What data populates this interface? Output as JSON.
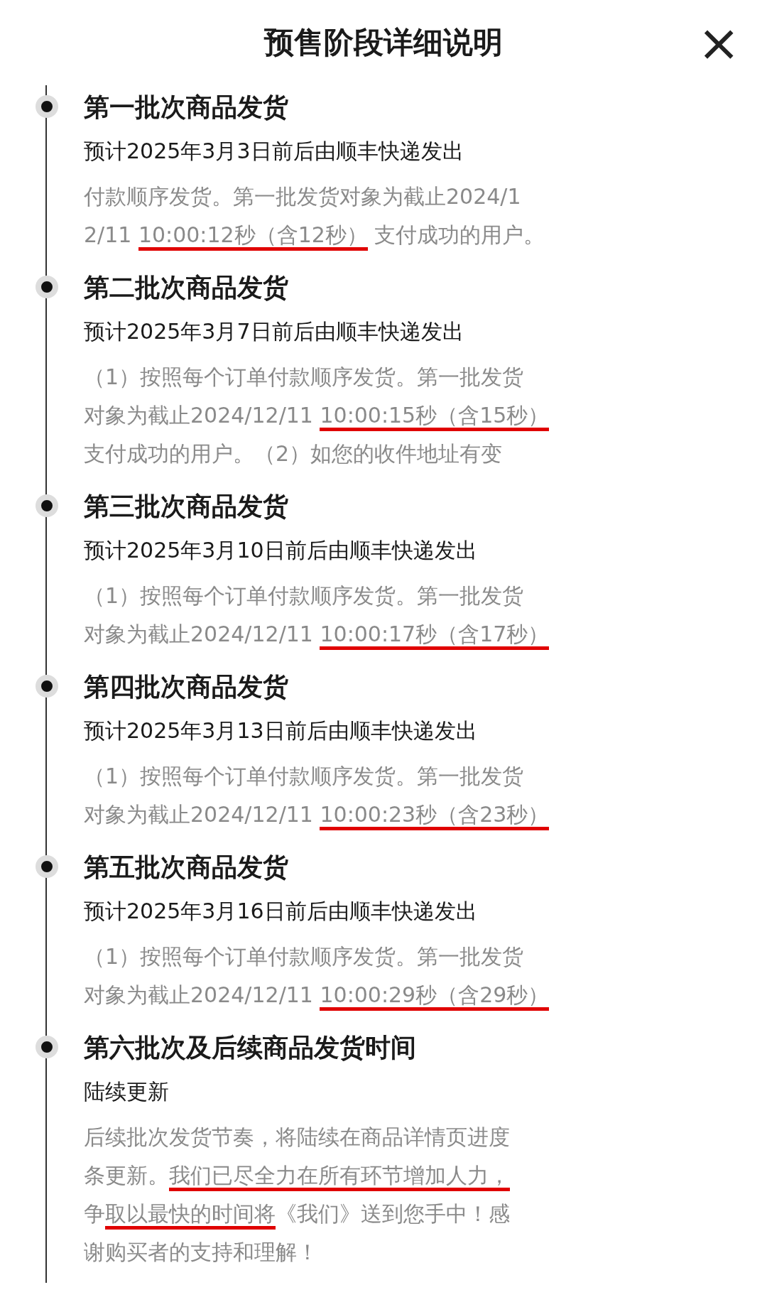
{
  "header": {
    "title": "预售阶段详细说明",
    "close": "×"
  },
  "sections": [
    {
      "heading": "第一批次商品发货",
      "subtitle": "预计2025年3月3日前后由顺丰快递发出",
      "details": [
        [
          {
            "text": "付款顺序发货。第一批发货对象为截止2024/1",
            "underlined": false
          }
        ],
        [
          {
            "text": "2/11 ",
            "underlined": false
          },
          {
            "text": "10:00:12秒（含12秒）",
            "underlined": true
          },
          {
            "text": " 支付成功的用户。",
            "underlined": false
          }
        ]
      ]
    },
    {
      "heading": "第二批次商品发货",
      "subtitle": "预计2025年3月7日前后由顺丰快递发出",
      "details": [
        [
          {
            "text": "（1）按照每个订单付款顺序发货。第一批发货",
            "underlined": false
          }
        ],
        [
          {
            "text": "对象为截止2024/12/11 ",
            "underlined": false
          },
          {
            "text": "10:00:15秒（含15秒）",
            "underlined": true
          }
        ],
        [
          {
            "text": "支付成功的用户。（2）如您的收件地址有变",
            "underlined": false
          }
        ]
      ]
    },
    {
      "heading": "第三批次商品发货",
      "subtitle": "预计2025年3月10日前后由顺丰快递发出",
      "details": [
        [
          {
            "text": "（1）按照每个订单付款顺序发货。第一批发货",
            "underlined": false
          }
        ],
        [
          {
            "text": "对象为截止2024/12/11 ",
            "underlined": false
          },
          {
            "text": "10:00:17秒（含17秒）",
            "underlined": true
          }
        ]
      ]
    },
    {
      "heading": "第四批次商品发货",
      "subtitle": "预计2025年3月13日前后由顺丰快递发出",
      "details": [
        [
          {
            "text": "（1）按照每个订单付款顺序发货。第一批发货",
            "underlined": false
          }
        ],
        [
          {
            "text": "对象为截止2024/12/11 ",
            "underlined": false
          },
          {
            "text": "10:00:23秒（含23秒）",
            "underlined": true
          }
        ]
      ]
    },
    {
      "heading": "第五批次商品发货",
      "subtitle": "预计2025年3月16日前后由顺丰快递发出",
      "details": [
        [
          {
            "text": "（1）按照每个订单付款顺序发货。第一批发货",
            "underlined": false
          }
        ],
        [
          {
            "text": "对象为截止2024/12/11 ",
            "underlined": false
          },
          {
            "text": "10:00:29秒（含29秒）",
            "underlined": true
          }
        ]
      ]
    },
    {
      "heading": "第六批次及后续商品发货时间",
      "subtitle": "陆续更新",
      "details": [
        [
          {
            "text": "后续批次发货节奏，将陆续在商品详情页进度",
            "underlined": false
          }
        ],
        [
          {
            "text": "条更新。",
            "underlined": false
          },
          {
            "text": "我们已尽全力在所有环节增加人力，",
            "underlined": true
          }
        ],
        [
          {
            "text": "争",
            "underlined": false
          },
          {
            "text": "取以最快的时间将",
            "underlined": true
          },
          {
            "text": "《我们》送到您手中！感",
            "underlined": false
          }
        ],
        [
          {
            "text": "谢购买者的支持和理解！",
            "underlined": false
          }
        ]
      ]
    }
  ]
}
